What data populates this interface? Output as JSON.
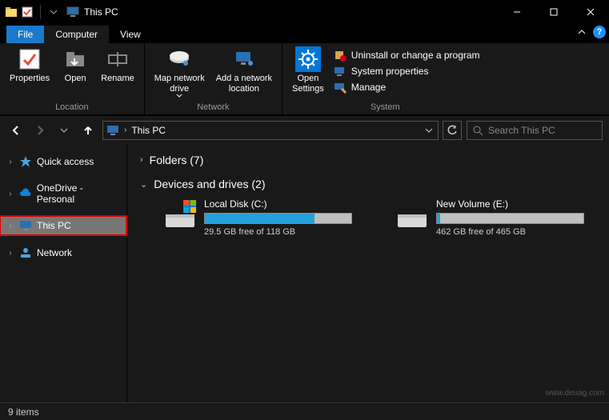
{
  "window": {
    "title": "This PC"
  },
  "tabs": {
    "file": "File",
    "computer": "Computer",
    "view": "View"
  },
  "ribbon": {
    "location": {
      "label": "Location",
      "properties": "Properties",
      "open": "Open",
      "rename": "Rename"
    },
    "network": {
      "label": "Network",
      "map_drive": "Map network\ndrive",
      "add_location": "Add a network\nlocation"
    },
    "system": {
      "label": "System",
      "open_settings": "Open\nSettings",
      "uninstall": "Uninstall or change a program",
      "sys_props": "System properties",
      "manage": "Manage"
    }
  },
  "address": {
    "path": "This PC"
  },
  "search": {
    "placeholder": "Search This PC"
  },
  "sidebar": {
    "quick_access": "Quick access",
    "onedrive": "OneDrive - Personal",
    "this_pc": "This PC",
    "network": "Network"
  },
  "sections": {
    "folders": {
      "label": "Folders (7)"
    },
    "drives": {
      "label": "Devices and drives (2)",
      "items": [
        {
          "name": "Local Disk (C:)",
          "free": "29.5 GB free of 118 GB",
          "fill_pct": 75
        },
        {
          "name": "New Volume (E:)",
          "free": "462 GB free of 465 GB",
          "fill_pct": 2
        }
      ]
    }
  },
  "status": {
    "items": "9 items"
  },
  "watermark": "www.deuag.com"
}
